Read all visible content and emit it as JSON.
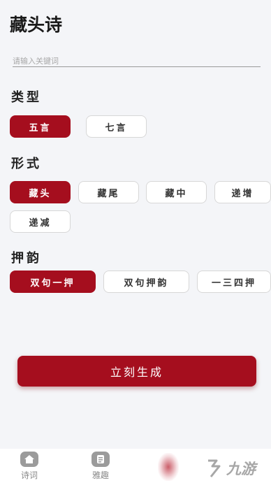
{
  "header": {
    "title": "藏头诗"
  },
  "search": {
    "placeholder": "请输入关键词",
    "value": ""
  },
  "type_section": {
    "title": "类型",
    "options": [
      {
        "label": "五言",
        "selected": true
      },
      {
        "label": "七言",
        "selected": false
      }
    ]
  },
  "form_section": {
    "title": "形式",
    "options": [
      {
        "label": "藏头",
        "selected": true
      },
      {
        "label": "藏尾",
        "selected": false
      },
      {
        "label": "藏中",
        "selected": false
      },
      {
        "label": "递增",
        "selected": false
      },
      {
        "label": "递减",
        "selected": false
      }
    ]
  },
  "rhyme_section": {
    "title": "押韵",
    "options": [
      {
        "label": "双句一押",
        "selected": true
      },
      {
        "label": "双句押韵",
        "selected": false
      },
      {
        "label": "一三四押",
        "selected": false
      }
    ]
  },
  "actions": {
    "generate_label": "立刻生成"
  },
  "tabbar": {
    "items": [
      {
        "label": "诗词",
        "icon": "home-icon"
      },
      {
        "label": "雅趣",
        "icon": "document-icon"
      }
    ]
  },
  "watermark": {
    "text": "九游"
  },
  "colors": {
    "accent": "#a50e1e",
    "background": "#f4f5f8"
  }
}
